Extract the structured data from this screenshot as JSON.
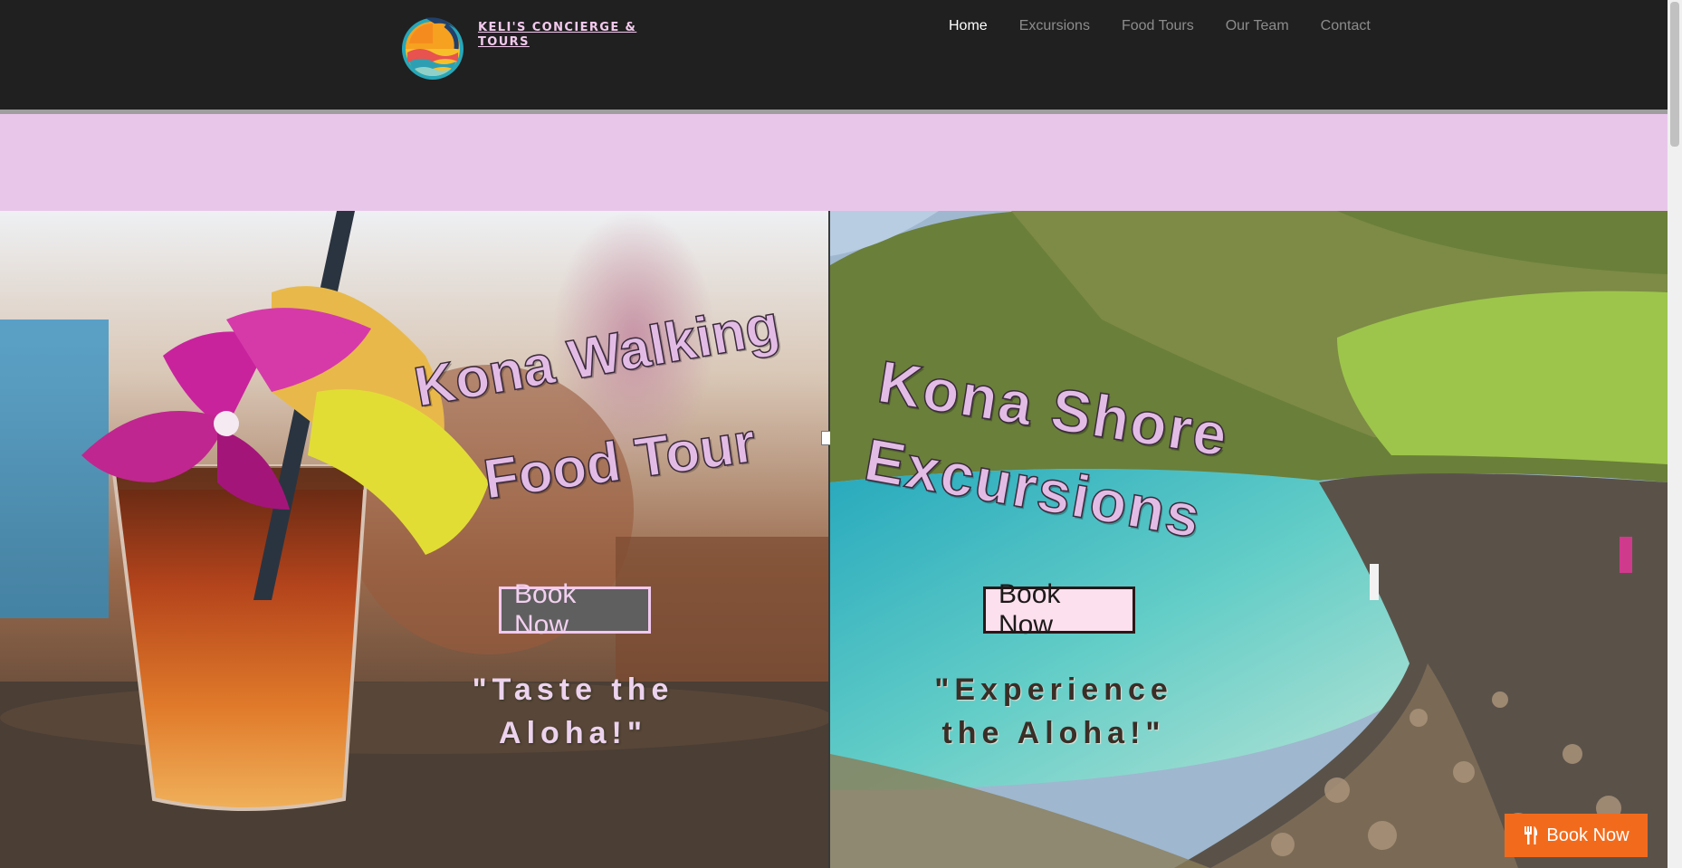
{
  "brand": {
    "name": "KELI'S CONCIERGE & TOURS",
    "logo_icon": "sunset-wave-logo-icon"
  },
  "nav": {
    "items": [
      {
        "label": "Home",
        "active": true
      },
      {
        "label": "Excursions",
        "active": false
      },
      {
        "label": "Food Tours",
        "active": false
      },
      {
        "label": "Our Team",
        "active": false
      },
      {
        "label": "Contact",
        "active": false
      }
    ]
  },
  "panels": {
    "left": {
      "title_line1": "Kona Walking",
      "title_line2": "Food Tour",
      "button_label": "Book Now",
      "tagline": "\"Taste the Aloha!\""
    },
    "right": {
      "title_line1": "Kona Shore",
      "title_line2": "Excursions",
      "button_label": "Book Now",
      "tagline": "\"Experience the Aloha!\""
    }
  },
  "float_button": {
    "label": "Book Now",
    "icon": "fork-knife-icon",
    "color": "#f26b1d"
  },
  "colors": {
    "header_bg": "#202020",
    "accent_pink": "#e8c6ea",
    "brand_text": "#f4c9ee"
  }
}
